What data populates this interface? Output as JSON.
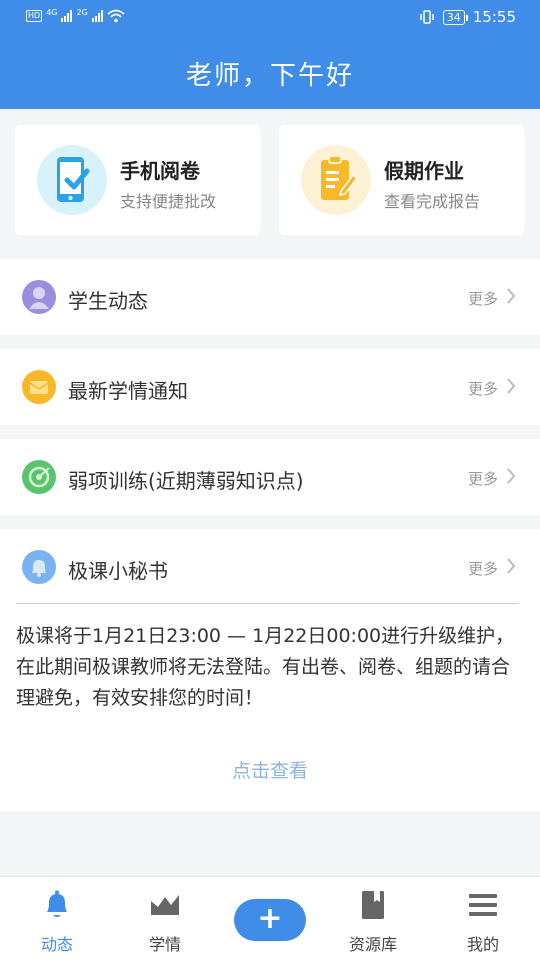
{
  "status_bar": {
    "network_badge": "HD",
    "signal1_type": "4G",
    "signal2_type": "2G",
    "battery": "34",
    "time": "15:55"
  },
  "header": {
    "greeting": "老师，下午好",
    "color": "#3f8ce9"
  },
  "quick_cards": [
    {
      "title": "手机阅卷",
      "subtitle": "支持便捷批改",
      "icon": "phone-check-icon"
    },
    {
      "title": "假期作业",
      "subtitle": "查看完成报告",
      "icon": "clipboard-edit-icon"
    }
  ],
  "sections": [
    {
      "label": "学生动态",
      "more": "更多",
      "icon": "student-icon"
    },
    {
      "label": "最新学情通知",
      "more": "更多",
      "icon": "envelope-icon"
    },
    {
      "label": "弱项训练(近期薄弱知识点)",
      "more": "更多",
      "icon": "target-icon"
    },
    {
      "label": "极课小秘书",
      "more": "更多",
      "icon": "bell-icon"
    }
  ],
  "notice": {
    "text": "极课将于1月21日23:00 — 1月22日00:00进行升级维护，在此期间极课教师将无法登陆。有出卷、阅卷、组题的请合理避免，有效安排您的时间！",
    "link": "点击查看"
  },
  "tabbar": {
    "items": [
      {
        "label": "动态",
        "icon": "bell-icon",
        "active": true
      },
      {
        "label": "学情",
        "icon": "chart-icon",
        "active": false
      },
      {
        "label": "+",
        "icon": "plus-icon",
        "active": false
      },
      {
        "label": "资源库",
        "icon": "book-icon",
        "active": false
      },
      {
        "label": "我的",
        "icon": "menu-icon",
        "active": false
      }
    ]
  }
}
